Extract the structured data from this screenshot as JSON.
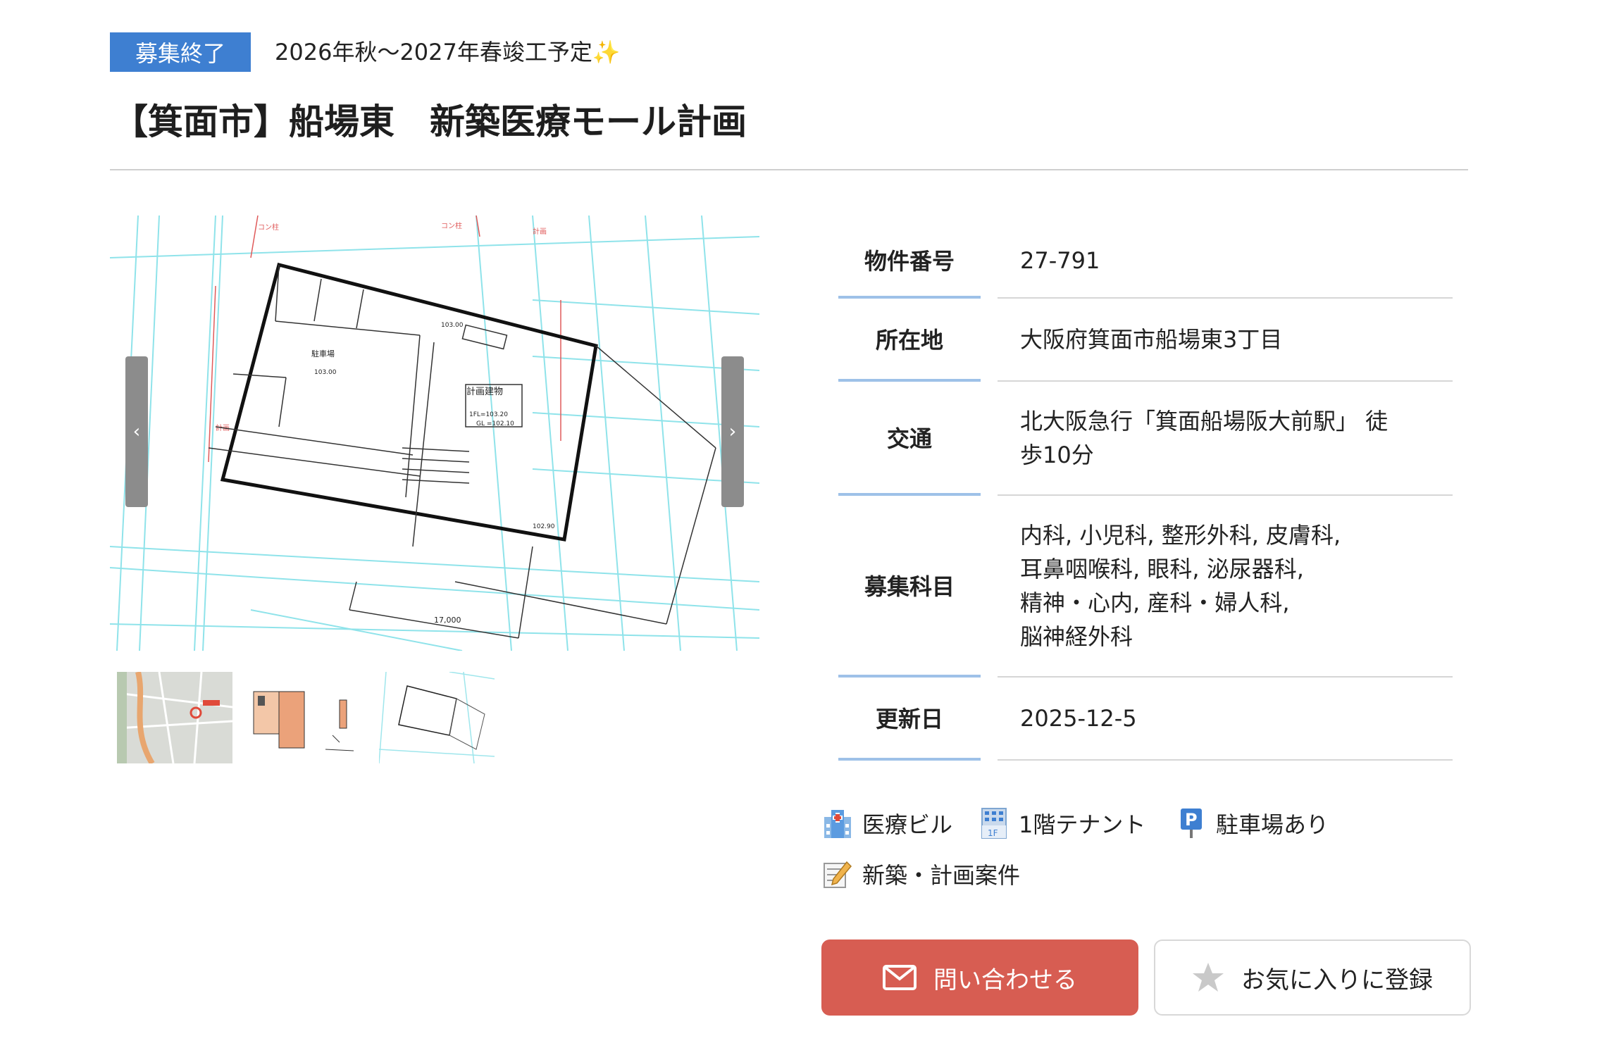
{
  "header": {
    "status": "募集終了",
    "schedule": "2026年秋〜2027年春竣工予定",
    "schedule_emoji": "✨",
    "title": "【箕面市】船場東　新築医療モール計画"
  },
  "gallery": {
    "main_drawing_labels": {
      "building": "計画建物",
      "parking": "駐車場"
    },
    "prev_icon": "chevron-left-icon",
    "next_icon": "chevron-right-icon",
    "thumbnails": [
      "map-thumbnail",
      "floorplan-thumbnail",
      "siteplan-thumbnail"
    ]
  },
  "info": {
    "rows": [
      {
        "label": "物件番号",
        "value": "27-791"
      },
      {
        "label": "所在地",
        "value": "大阪府箕面市船場東3丁目"
      },
      {
        "label": "交通",
        "value_lines": [
          "北大阪急行「箕面船場阪大前駅」 徒",
          "歩10分"
        ]
      },
      {
        "label": "募集科目",
        "value_lines": [
          "内科, 小児科, 整形外科, 皮膚科,",
          "耳鼻咽喉科, 眼科, 泌尿器科,",
          "精神・心内, 産科・婦人科,",
          "脳神経外科"
        ]
      },
      {
        "label": "更新日",
        "value": "2025-12-5"
      }
    ]
  },
  "tags": [
    {
      "label": "医療ビル",
      "icon": "hospital-icon"
    },
    {
      "label": "1階テナント",
      "icon": "building-1f-icon"
    },
    {
      "label": "駐車場あり",
      "icon": "parking-icon"
    },
    {
      "label": "新築・計画案件",
      "icon": "memo-pencil-icon"
    }
  ],
  "buttons": {
    "contact": "問い合わせる",
    "favorite": "お気に入りに登録"
  },
  "colors": {
    "badge": "#3e7fd1",
    "contact_button": "#d75d52",
    "label_underline": "#9ec1e8",
    "blueprint_cyan": "#8fe3ea"
  }
}
